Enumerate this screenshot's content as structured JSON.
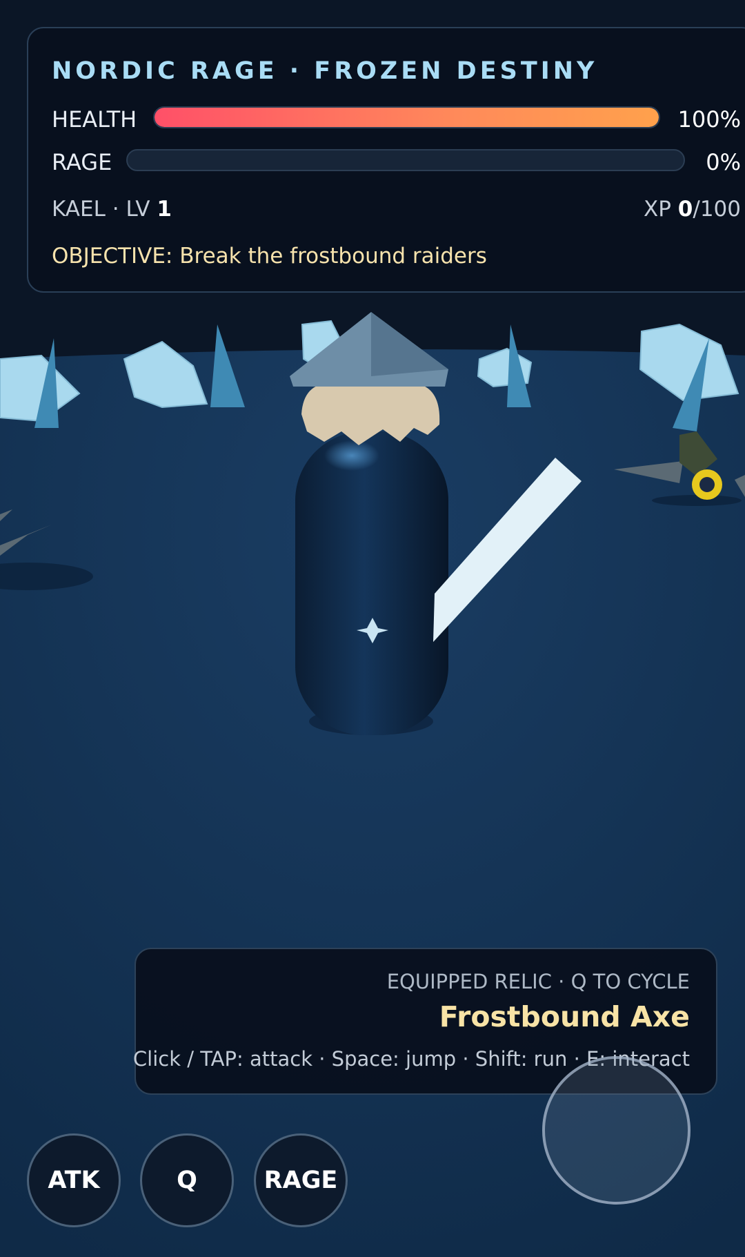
{
  "hud": {
    "title": "NORDIC RAGE · FROZEN DESTINY",
    "health": {
      "label": "HEALTH",
      "value_text": "100%",
      "fraction": 1.0
    },
    "rage": {
      "label": "RAGE",
      "value_text": "0%",
      "fraction": 0.0
    },
    "character": {
      "name": "KAEL",
      "level_label": "LV",
      "level": "1"
    },
    "xp": {
      "label": "XP",
      "current": "0",
      "max": "/100"
    },
    "objective": {
      "label": "OBJECTIVE",
      "text": "Break the frostbound raiders"
    }
  },
  "relic": {
    "caption": "EQUIPPED RELIC · Q TO CYCLE",
    "name": "Frostbound Axe",
    "controls": "Click / TAP: attack · Space: jump · Shift: run · E: interact"
  },
  "buttons": {
    "attack": "ATK",
    "cycle": "Q",
    "rage": "RAGE"
  },
  "colors": {
    "ground": "#143254",
    "sky": "#0b1626",
    "ice": "#a9d9ee",
    "health_start": "#ff5068",
    "health_end": "#ffa14c",
    "title": "#a9dcf5",
    "relic_name": "#f8e3a6"
  }
}
